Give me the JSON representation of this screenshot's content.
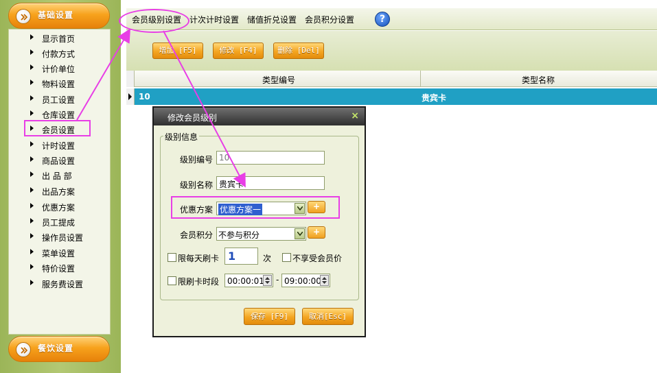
{
  "sidebar": {
    "top_section": "基础设置",
    "bottom_section": "餐饮设置",
    "items": [
      {
        "label": "显示首页"
      },
      {
        "label": "付款方式"
      },
      {
        "label": "计价单位"
      },
      {
        "label": "物料设置"
      },
      {
        "label": "员工设置"
      },
      {
        "label": "仓库设置"
      },
      {
        "label": "会员设置"
      },
      {
        "label": "计时设置"
      },
      {
        "label": "商品设置"
      },
      {
        "label": "出 品 部"
      },
      {
        "label": "出品方案"
      },
      {
        "label": "优惠方案"
      },
      {
        "label": "员工提成"
      },
      {
        "label": "操作员设置"
      },
      {
        "label": "菜单设置"
      },
      {
        "label": "特价设置"
      },
      {
        "label": "服务费设置"
      }
    ]
  },
  "tabs": [
    {
      "label": "会员级别设置"
    },
    {
      "label": "计次计时设置"
    },
    {
      "label": "储值折兑设置"
    },
    {
      "label": "会员积分设置"
    }
  ],
  "help_label": "?",
  "toolbar": {
    "add": "增加 [F5]",
    "edit": "修改 [F4]",
    "delete": "删除 [Del]"
  },
  "grid": {
    "columns": [
      "类型编号",
      "类型名称"
    ],
    "rows": [
      {
        "code": "10",
        "name": "贵宾卡"
      }
    ]
  },
  "dialog": {
    "title": "修改会员级别",
    "close": "×",
    "group_label": "级别信息",
    "code_label": "级别编号",
    "code_value": "10",
    "name_label": "级别名称",
    "name_value": "贵宾卡",
    "discount_label": "优惠方案",
    "discount_value": "优惠方案一",
    "points_label": "会员积分",
    "points_value": "不参与积分",
    "plus": "+",
    "daily_limit_label": "限每天刷卡",
    "daily_limit_value": "1",
    "daily_limit_unit": "次",
    "no_member_price_label": "不享受会员价",
    "time_limit_label": "限刷卡时段",
    "time_from": "00:00:01",
    "time_sep": "-",
    "time_to": "09:00:00",
    "save": "保存 [F9]",
    "cancel": "取消[Esc]"
  },
  "colors": {
    "accent_orange": "#f4a521",
    "selected_row": "#20a0c4",
    "annotation": "#e83ee6"
  }
}
